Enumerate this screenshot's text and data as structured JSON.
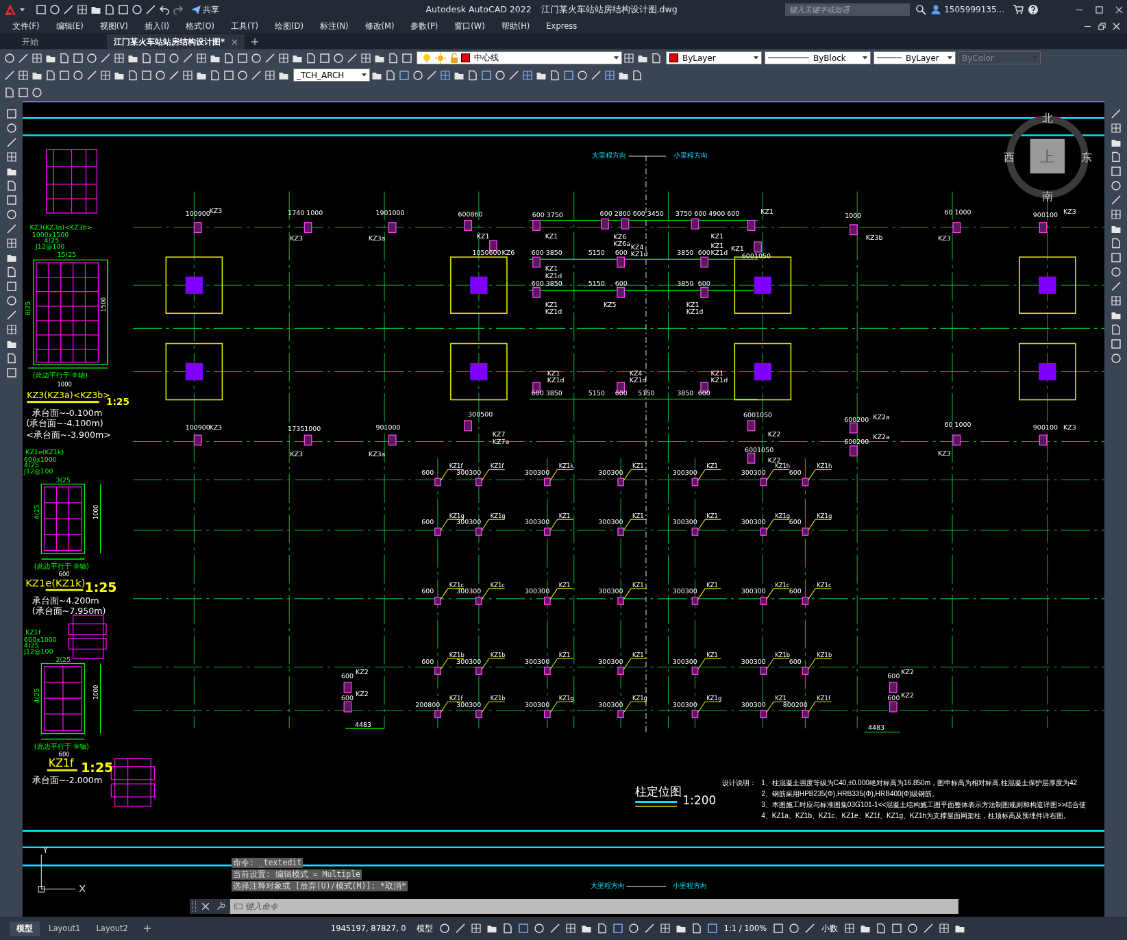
{
  "title_bar": {
    "app_title": "Autodesk AutoCAD 2022",
    "file_name": "江门某火车站站房结构设计图.dwg",
    "share": "共享",
    "search": {
      "placeholder": "键入关键字或短语"
    },
    "user": "1505999135..."
  },
  "menu": [
    "文件(F)",
    "编辑(E)",
    "视图(V)",
    "插入(I)",
    "格式(O)",
    "工具(T)",
    "绘图(D)",
    "标注(N)",
    "修改(M)",
    "参数(P)",
    "窗口(W)",
    "帮助(H)",
    "Express"
  ],
  "file_tabs": [
    {
      "label": "开始",
      "selected": false
    },
    {
      "label": "江门某火车站站房结构设计图*",
      "selected": true
    }
  ],
  "toolbar": {
    "layer": "中心线",
    "color_control": "ByLayer",
    "linetype": "ByBlock",
    "lineweight": "ByLayer",
    "plot_style": {
      "value": "ByColor",
      "disabled": true
    },
    "text_style": "_TCH_ARCH"
  },
  "drawing": {
    "compass": {
      "north": "北",
      "south": "南",
      "west": "西",
      "east": "东",
      "top": "上"
    },
    "direction_labels": [
      "大里程方向",
      "小里程方向",
      "大里程方向",
      "小里程方向"
    ],
    "dimension_labels": [
      "100900",
      "KZ3",
      "1740 1000",
      "KZ3",
      "1901000",
      "KZ3a",
      "600860",
      "KZ1",
      "600 3750",
      "600 2800 600 3450",
      "3750 600 4900 600",
      "KZ1",
      "1000",
      "KZ3b",
      "60 1000",
      "KZ3",
      "900100",
      "KZ3",
      "1050600",
      "KZ6",
      "600 3850",
      "5150",
      "600",
      "3850",
      "600",
      "600 3850",
      "5150",
      "600",
      "3850",
      "600",
      "KZ1",
      "KZ1",
      "KZ1d",
      "KZ1",
      "KZ1d",
      "KZ6",
      "KZ6a",
      "KZ4",
      "KZ1d",
      "KZ5",
      "KZ1",
      "KZ1d",
      "KZ1",
      "KZ1",
      "KZ1d",
      "KZ1",
      "6001050",
      "600 3850",
      "5150",
      "600",
      "5150",
      "3850",
      "600",
      "KZ1",
      "KZ1d",
      "KZ4",
      "KZ1d",
      "KZ1",
      "KZ1d",
      "100900",
      "KZ3",
      "17351000",
      "KZ3",
      "901000",
      "KZ3a",
      "300500",
      "KZ7",
      "KZ7a",
      "6001050",
      "KZ2",
      "6001050",
      "KZ2",
      "600200",
      "KZ2a",
      "600200",
      "KZ2a",
      "60 1000",
      "KZ3",
      "900100",
      "KZ3",
      "600",
      "KZ2",
      "600",
      "KZ2",
      "4483",
      "600",
      "KZ2",
      "600",
      "KZ2",
      "4483"
    ],
    "columns": [
      {
        "dim": "600",
        "tag": "KZ1f"
      },
      {
        "dim": "300300",
        "tag": "KZ1f"
      },
      {
        "dim": "300300",
        "tag": "KZ1k"
      },
      {
        "dim": "300300",
        "tag": "KZ1"
      },
      {
        "dim": "300300",
        "tag": "KZ1"
      },
      {
        "dim": "300300",
        "tag": "KZ1h"
      },
      {
        "dim": "600",
        "tag": "KZ1h"
      },
      {
        "dim": "600",
        "tag": "KZ1g"
      },
      {
        "dim": "300300",
        "tag": "KZ1g"
      },
      {
        "dim": "300300",
        "tag": "KZ1"
      },
      {
        "dim": "300300",
        "tag": "KZ1"
      },
      {
        "dim": "300300",
        "tag": "KZ1"
      },
      {
        "dim": "300300",
        "tag": "KZ1g"
      },
      {
        "dim": "600",
        "tag": "KZ1g"
      },
      {
        "dim": "600",
        "tag": "KZ1c"
      },
      {
        "dim": "300300",
        "tag": "KZ1c"
      },
      {
        "dim": "300300",
        "tag": "KZ1"
      },
      {
        "dim": "300300",
        "tag": "KZ1"
      },
      {
        "dim": "300300",
        "tag": "KZ1"
      },
      {
        "dim": "300300",
        "tag": "KZ1c"
      },
      {
        "dim": "600",
        "tag": "KZ1c"
      },
      {
        "dim": "600",
        "tag": "KZ1b"
      },
      {
        "dim": "300300",
        "tag": "KZ1b"
      },
      {
        "dim": "300300",
        "tag": "KZ1"
      },
      {
        "dim": "300300",
        "tag": "KZ1"
      },
      {
        "dim": "300300",
        "tag": "KZ1"
      },
      {
        "dim": "300300",
        "tag": "KZ1b"
      },
      {
        "dim": "600",
        "tag": "KZ1b"
      },
      {
        "dim": "200800",
        "tag": "KZ1f"
      },
      {
        "dim": "300300",
        "tag": "KZ1b"
      },
      {
        "dim": "300300",
        "tag": "KZ1g"
      },
      {
        "dim": "300300",
        "tag": "KZ1g"
      },
      {
        "dim": "300300",
        "tag": "KZ1g"
      },
      {
        "dim": "300300",
        "tag": "KZ1"
      },
      {
        "dim": "800200",
        "tag": "KZ1f"
      }
    ],
    "legend_labels": [
      "KZ3(KZ3a)<KZ3b>",
      "1000x1500",
      "4(25",
      "J12@100",
      "15(25",
      "8(25",
      "1500",
      "(此边平行于 ⑨轴)",
      "1000",
      "KZ3(KZ3a)<KZ3b>",
      "1:25",
      "承台面~-0.100m",
      "(承台面~-4.100m)",
      "<承台面~-3.900m>",
      "KZ1e(KZ1k)",
      "600x1000",
      "4(25",
      "J12@100",
      "3(25",
      "4(25",
      "1000",
      "(此边平行于 ⑨轴)",
      "600",
      "KZ1e(KZ1k)",
      "1:25",
      "承台面~4.200m",
      "(承台面~7.950m)",
      "KZ1f",
      "600x1000",
      "4(25",
      "J12@100",
      "2(25",
      "4(25",
      "1000",
      "(此边平行于 ⑨轴)",
      "600",
      "KZ1f",
      "1:25",
      "承台面~-2.000m"
    ],
    "plan_title": "柱定位图",
    "plan_scale": "1:200",
    "notes": {
      "heading": "设计说明：",
      "lines": [
        "1、柱混凝土强度等级为C40,±0.000绝对标高为16.850m，图中标高为相对标高,柱混凝土保护层厚度为42",
        "2、钢筋采用HPB235(Φ),HRB335(Φ),HRB400(Φ)级钢筋。",
        "3、本图施工时应与标准图集03G101-1<<混凝土结构施工图平面整体表示方法制图规则和构造详图>>结合使",
        "4、KZ1a、KZ1b、KZ1c、KZ1e、KZ1f、KZ1g、KZ1h为支撑屋面网架柱，柱顶标高及预埋件详右图。"
      ]
    },
    "ucs": {
      "y": "Y",
      "x": "X"
    }
  },
  "command_history": [
    "命令: _textedit",
    "当前设置: 编辑模式 = Multiple",
    "选择注释对象或 [放弃(U)/模式(M)]: *取消*"
  ],
  "command_line": {
    "placeholder": "键入命令"
  },
  "layout_tabs": [
    {
      "label": "模型",
      "selected": true
    },
    {
      "label": "Layout1",
      "selected": false
    },
    {
      "label": "Layout2",
      "selected": false
    }
  ],
  "status_bar": {
    "coordinates": "1945197, 87827, 0",
    "space": "模型",
    "scale": "1:1 / 100%",
    "units": "小数"
  }
}
